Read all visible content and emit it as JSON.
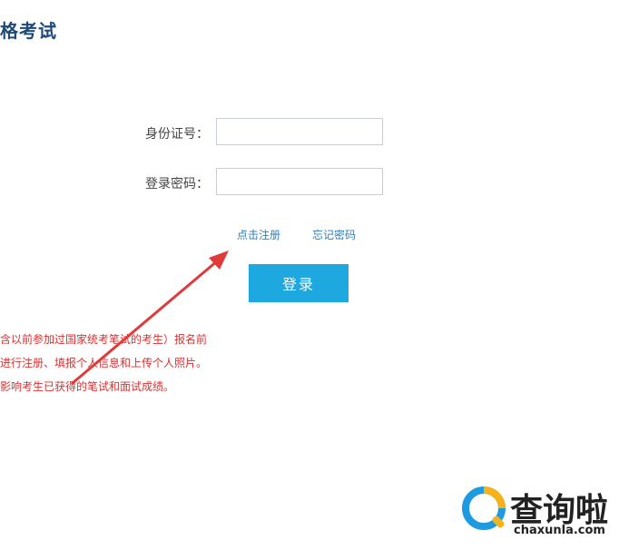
{
  "page": {
    "title": "格考试"
  },
  "form": {
    "id_label": "身份证号：",
    "id_value": "",
    "password_label": "登录密码：",
    "password_value": ""
  },
  "links": {
    "register": "点击注册",
    "forgot_password": "忘记密码"
  },
  "login_button": "登录",
  "notice": {
    "lines": [
      "含以前参加过国家统考笔试的考生）报名前",
      "进行注册、填报个人信息和上传个人照片。",
      "影响考生已获得的笔试和面试成绩。"
    ]
  },
  "watermark": {
    "text": "查询啦",
    "domain": "chaxunla.com"
  },
  "colors": {
    "title": "#1c4a7a",
    "link": "#2f7fb8",
    "button": "#1ea8e0",
    "notice": "#d83232",
    "annotation_arrow": "#e03a3a"
  }
}
